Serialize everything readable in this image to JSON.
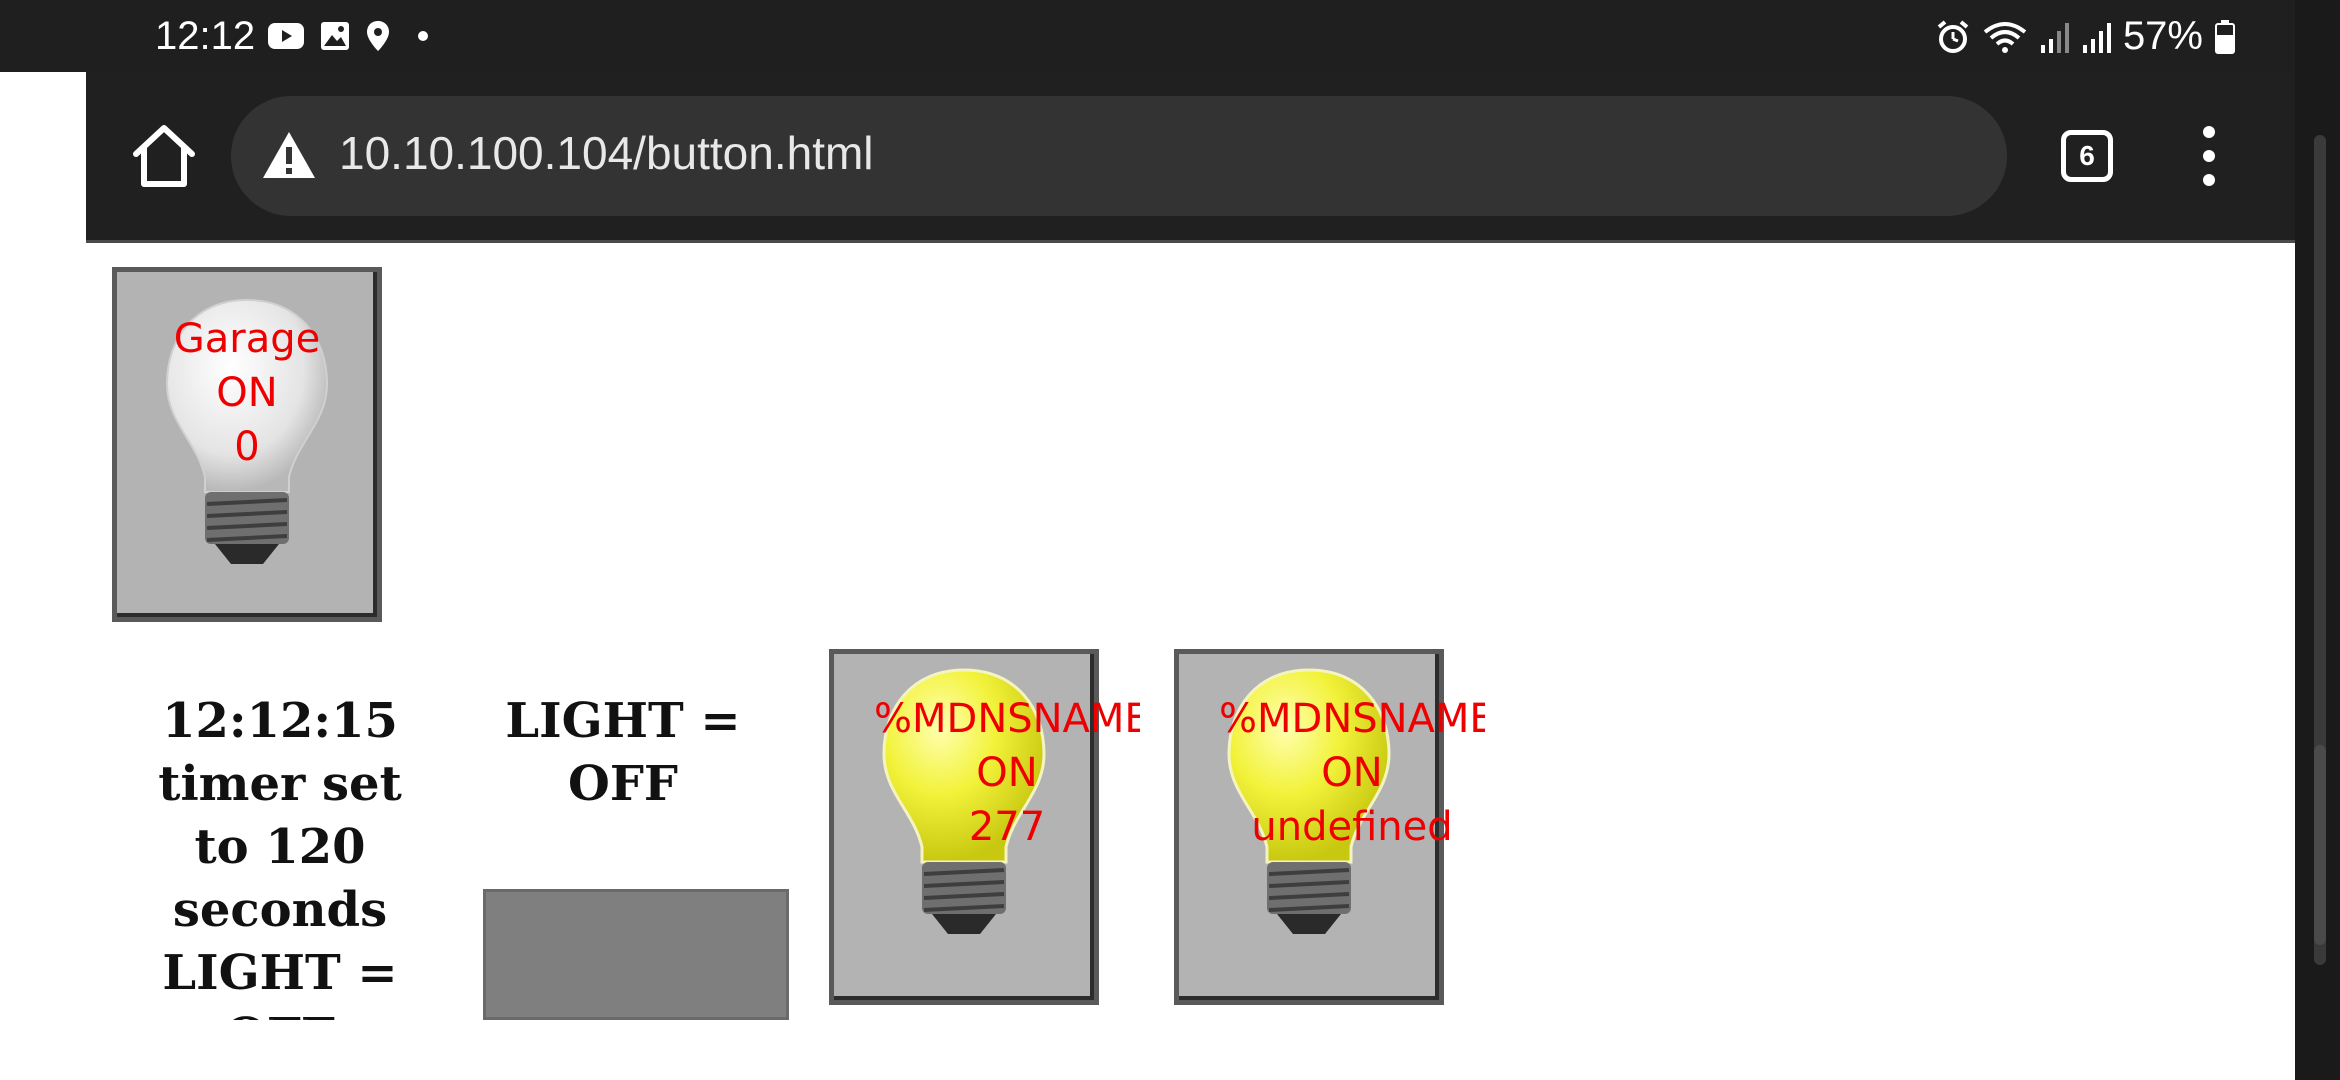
{
  "status_bar": {
    "time": "12:12",
    "battery": "57%",
    "left_icons": [
      "youtube-icon",
      "image-icon",
      "location-icon"
    ],
    "right_icons": [
      "alarm-icon",
      "wifi-icon",
      "signal-icon",
      "signal-icon",
      "battery-icon"
    ]
  },
  "browser": {
    "url": "10.10.100.104/button.html",
    "tab_count": "6"
  },
  "page": {
    "garage_button": {
      "line1": "Garage",
      "line2": "ON",
      "line3": "0"
    },
    "status_text": {
      "line1": "12:12:15",
      "line2": "timer set",
      "line3": "to 120",
      "line4": "seconds",
      "line5": "LIGHT =",
      "line6": "OFF"
    },
    "light_text": {
      "line1": "LIGHT =",
      "line2": "OFF"
    },
    "bulb_button_1": {
      "line1": "%MDNSNAME%",
      "line2": "ON",
      "line3": "277"
    },
    "bulb_button_2": {
      "line1": "%MDNSNAME%",
      "line2": "ON",
      "line3": "undefined"
    }
  },
  "colors": {
    "label_red": "#ee0000",
    "button_gray": "#b3b3b3",
    "toolbar_dark": "#202020"
  }
}
